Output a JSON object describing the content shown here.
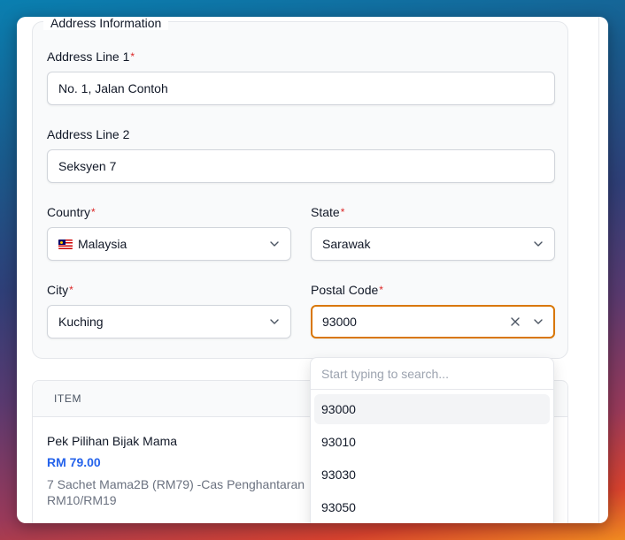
{
  "address_section": {
    "legend": "Address Information",
    "address_line1": {
      "label": "Address Line 1",
      "required_mark": "*",
      "value": "No. 1, Jalan Contoh"
    },
    "address_line2": {
      "label": "Address Line 2",
      "value": "Seksyen 7"
    },
    "country": {
      "label": "Country",
      "required_mark": "*",
      "flag_icon": "malaysia-flag-icon",
      "value": "Malaysia"
    },
    "state": {
      "label": "State",
      "required_mark": "*",
      "value": "Sarawak"
    },
    "city": {
      "label": "City",
      "required_mark": "*",
      "value": "Kuching"
    },
    "postal_code": {
      "label": "Postal Code",
      "required_mark": "*",
      "value": "93000"
    }
  },
  "postal_dropdown": {
    "search_placeholder": "Start typing to search...",
    "options": [
      "93000",
      "93010",
      "93030",
      "93050"
    ],
    "highlighted": "93000"
  },
  "items_table": {
    "header": "ITEM",
    "rows": [
      {
        "name": "Pek Pilihan Bijak Mama",
        "price": "RM 79.00",
        "description": "7 Sachet Mama2B (RM79) -Cas Penghantaran RM10/RM19"
      }
    ]
  },
  "colors": {
    "focus_border": "#d97706",
    "required_mark": "#dc2626",
    "price": "#2563eb"
  }
}
